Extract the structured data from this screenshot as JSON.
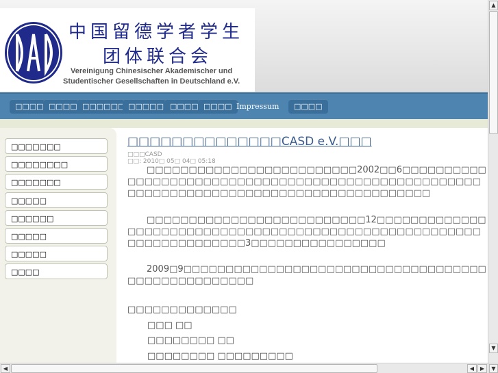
{
  "header": {
    "title_cn_line1": "中国留德学者学生",
    "title_cn_line2": "团体联合会",
    "title_de_line1": "Vereinigung Chinesischer Akademischer und",
    "title_de_line2": "Studentischer Gesellschaften in Deutschland e.V.",
    "logo_text": "GAD"
  },
  "nav": {
    "items": [
      "□□□□",
      "□□□□",
      "□□□□□□",
      "□□□□□",
      "□□□□",
      "□□□□",
      "Impressum",
      "□□□□"
    ]
  },
  "sidebar": {
    "items": [
      "□□□□□□□",
      "□□□□□□□□",
      "□□□□□□□",
      "□□□□□",
      "□□□□□□",
      "□□□□□",
      "□□□□□",
      "□□□□"
    ]
  },
  "article": {
    "title": "□□□□□□□□□□□□□□CASD e.V.□□□",
    "author": "□□□CASD",
    "date": "□□: 2010□ 05□ 04□ 05:18",
    "para1": "□□□□□□□□□□□□□□□□□□□□□□□□□2002□□6□□□□□□□□□□□□□□□□□□□□□□□□□□□□□□□□□□□□□□□□□□□□□□□□□□□□□□□□□□□□□□□□□□□□□□□□□□□□□□□□□□□□□□□□",
    "para2": "□□□□□□□□□□□□□□□□□□□□□□□□□□12□□□□□□□□□□□□□□□□□□□□□□□□□□□□□□□□□□□□□□□□□□□□□□□□□□□□□□□□□□□□□□□□□□□□□3□□□□□□□□□□□□□□□□",
    "para3": "2009□9□□□□□□□□□□□□□□□□□□□□□□□□□□□□□□□□□□□□□□□□□□□□□□□□□□□",
    "list_heading": "□□□□□□□□□□□□□",
    "list_items": [
      "□□□  □□",
      "□□□□□□□□ □□",
      "□□□□□□□□ □□□□□□□□□"
    ]
  }
}
